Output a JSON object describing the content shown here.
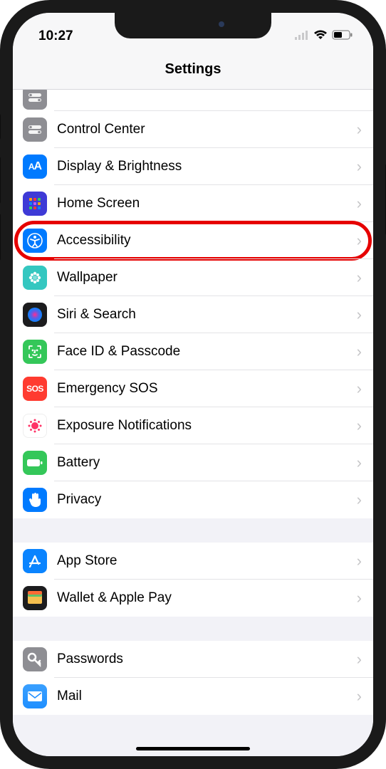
{
  "status": {
    "time": "10:27",
    "wifi": true,
    "battery": true
  },
  "nav": {
    "title": "Settings"
  },
  "groups": [
    {
      "partial_top": {
        "icon": "toggles",
        "color": "#8e8e93"
      },
      "items": [
        {
          "key": "control-center",
          "label": "Control Center",
          "icon": "toggles",
          "color": "#8e8e93"
        },
        {
          "key": "display-brightness",
          "label": "Display & Brightness",
          "icon": "aa",
          "color": "#007aff"
        },
        {
          "key": "home-screen",
          "label": "Home Screen",
          "icon": "grid",
          "color": "#3e3ad6"
        },
        {
          "key": "accessibility",
          "label": "Accessibility",
          "icon": "accessibility",
          "color": "#007aff",
          "highlighted": true
        },
        {
          "key": "wallpaper",
          "label": "Wallpaper",
          "icon": "flower",
          "color": "#34c7c0"
        },
        {
          "key": "siri-search",
          "label": "Siri & Search",
          "icon": "siri",
          "color": "#1c1c1e"
        },
        {
          "key": "face-id",
          "label": "Face ID & Passcode",
          "icon": "faceid",
          "color": "#34c759"
        },
        {
          "key": "emergency-sos",
          "label": "Emergency SOS",
          "icon": "sos",
          "color": "#ff3b30"
        },
        {
          "key": "exposure-notifications",
          "label": "Exposure Notifications",
          "icon": "exposure",
          "color": "#ffffff"
        },
        {
          "key": "battery",
          "label": "Battery",
          "icon": "battery",
          "color": "#34c759"
        },
        {
          "key": "privacy",
          "label": "Privacy",
          "icon": "hand",
          "color": "#007aff"
        }
      ]
    },
    {
      "items": [
        {
          "key": "app-store",
          "label": "App Store",
          "icon": "appstore",
          "color": "#0a84ff"
        },
        {
          "key": "wallet",
          "label": "Wallet & Apple Pay",
          "icon": "wallet",
          "color": "#1c1c1e"
        }
      ]
    },
    {
      "items": [
        {
          "key": "passwords",
          "label": "Passwords",
          "icon": "key",
          "color": "#8e8e93"
        },
        {
          "key": "mail",
          "label": "Mail",
          "icon": "mail",
          "color": "#1f8fff"
        }
      ]
    }
  ]
}
